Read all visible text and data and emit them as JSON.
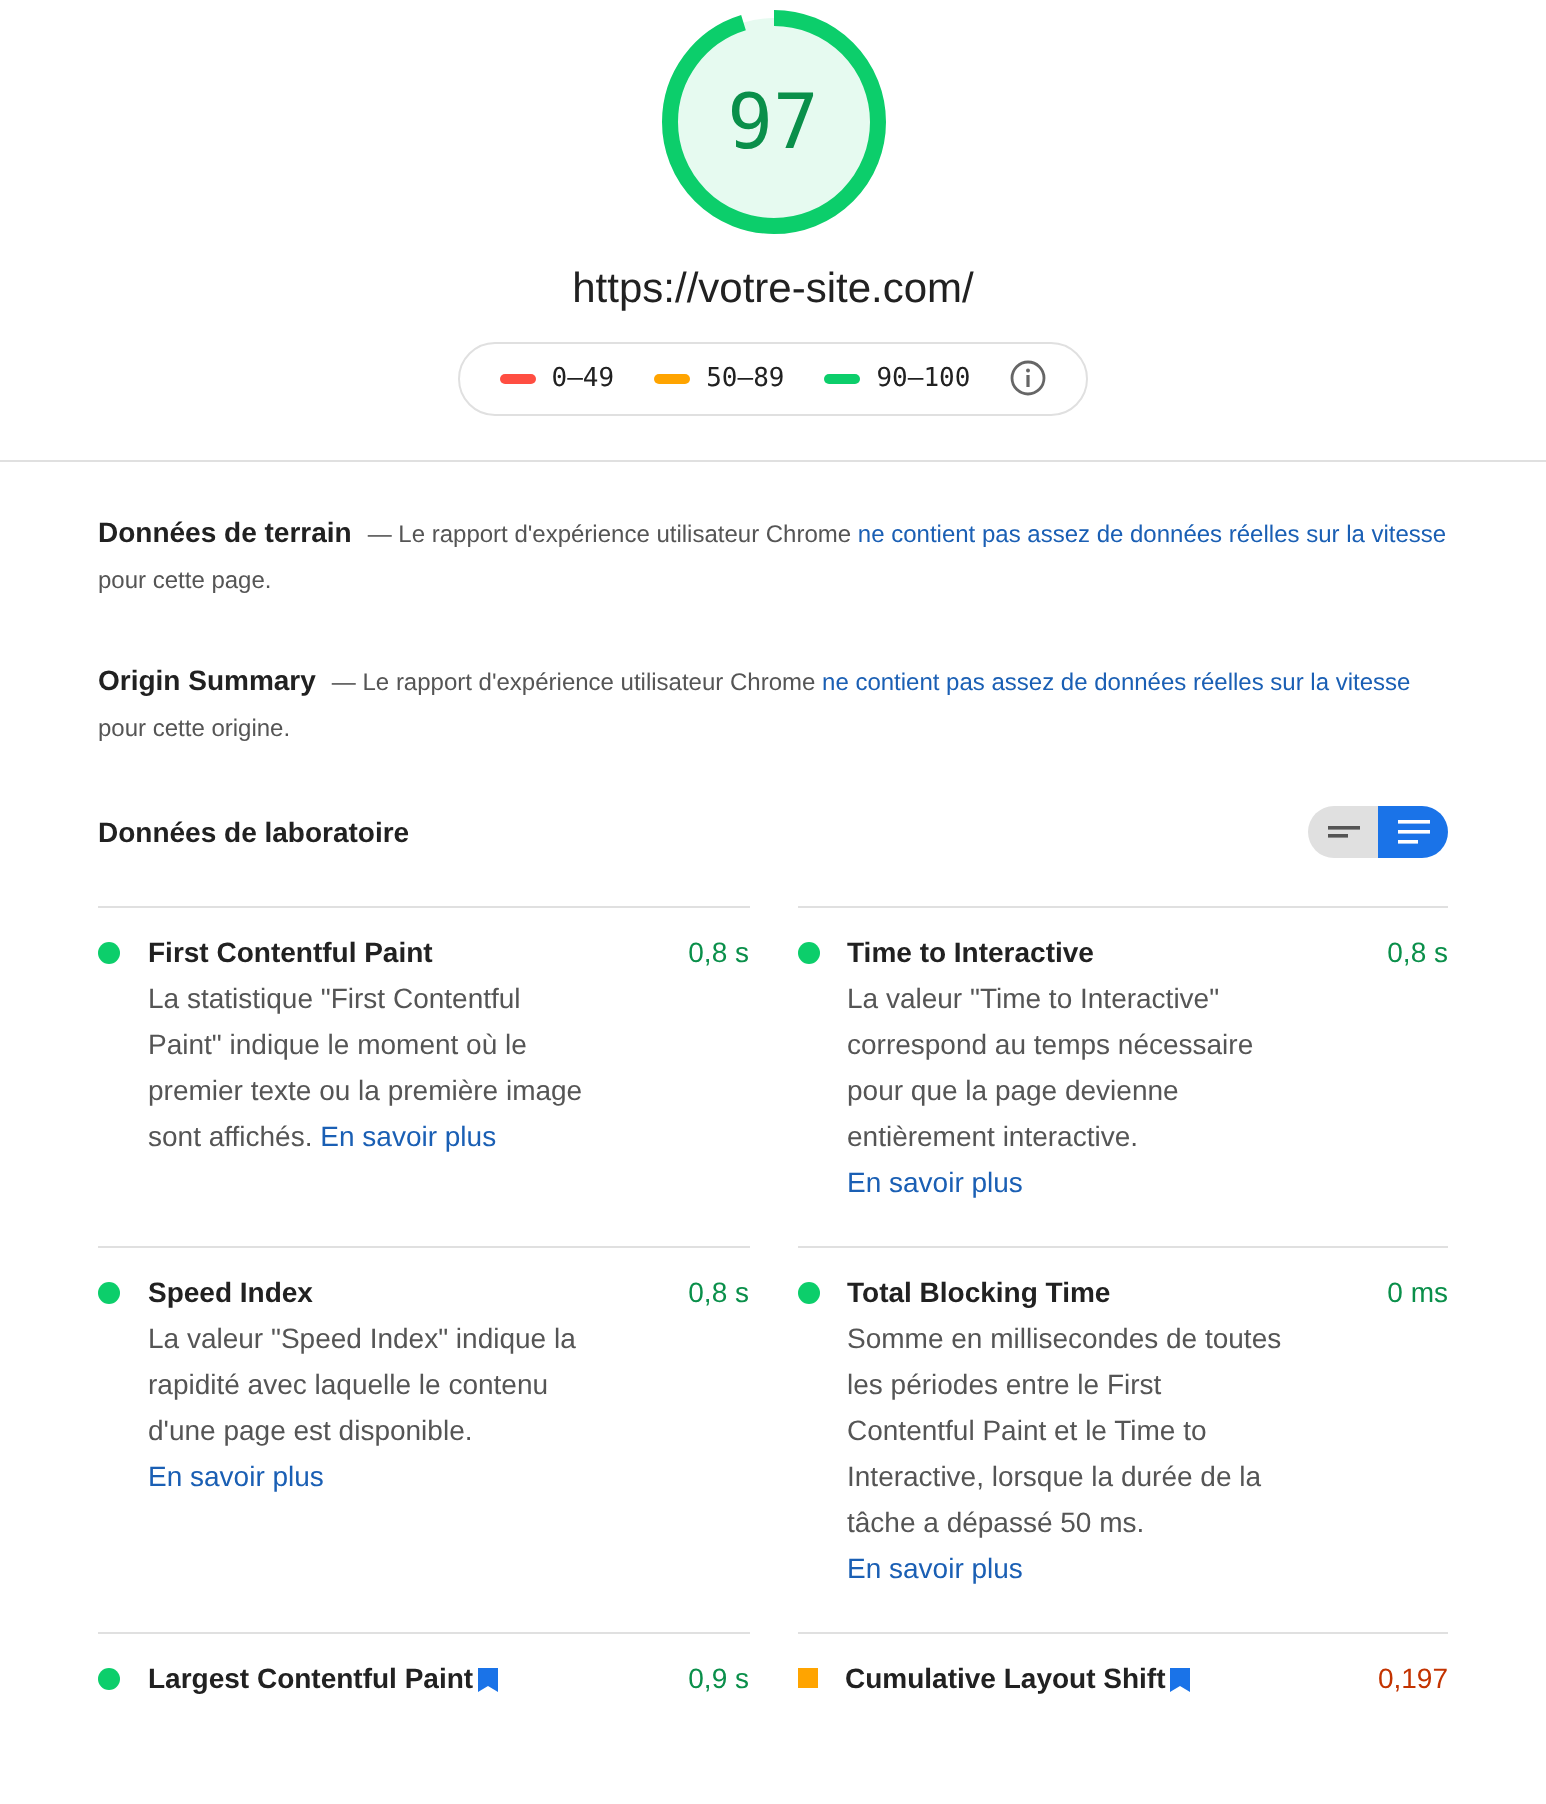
{
  "score": {
    "value": "97",
    "color": "#0cce6b"
  },
  "url": "https://votre-site.com/",
  "legend": [
    {
      "range": "0–49",
      "color": "#ff4e42"
    },
    {
      "range": "50–89",
      "color": "#ffa400"
    },
    {
      "range": "90–100",
      "color": "#0cce6b"
    }
  ],
  "field_sections": [
    {
      "title": "Données de terrain",
      "text_before": "— Le rapport d'expérience utilisateur Chrome",
      "link": "ne contient pas assez de données réelles sur la vitesse",
      "text_after": "pour cette page."
    },
    {
      "title": "Origin Summary",
      "text_before": "— Le rapport d'expérience utilisateur Chrome",
      "link": "ne contient pas assez de données réelles sur la vitesse",
      "text_after": "pour cette origine."
    }
  ],
  "lab": {
    "title": "Données de laboratoire",
    "view_toggle": [
      {
        "kind": "compact",
        "selected": false
      },
      {
        "kind": "expanded",
        "selected": true
      }
    ],
    "metrics": [
      {
        "name": "First Contentful Paint",
        "value": "0,8 s",
        "kind": "circle",
        "color": "#0cce6b",
        "flagged": false,
        "description": "La statistique \"First Contentful Paint\" indique le moment où le premier texte ou la première image sont affichés.",
        "link": "En savoir plus"
      },
      {
        "name": "Time to Interactive",
        "value": "0,8 s",
        "kind": "circle",
        "color": "#0cce6b",
        "flagged": false,
        "description": "La valeur \"Time to Interactive\" correspond au temps nécessaire pour que la page devienne entièrement interactive.",
        "link": "En savoir plus"
      },
      {
        "name": "Speed Index",
        "value": "0,8 s",
        "kind": "circle",
        "color": "#0cce6b",
        "flagged": false,
        "description": "La valeur \"Speed Index\" indique la rapidité avec laquelle le contenu d'une page est disponible.",
        "link": "En savoir plus"
      },
      {
        "name": "Total Blocking Time",
        "value": "0 ms",
        "kind": "circle",
        "color": "#0cce6b",
        "flagged": false,
        "description": "Somme en millisecondes de toutes les périodes entre le First Contentful Paint et le Time to Interactive, lorsque la durée de la tâche a dépassé 50 ms.",
        "link": "En savoir plus"
      },
      {
        "name": "Largest Contentful Paint",
        "value": "0,9 s",
        "kind": "circle",
        "color": "#0cce6b",
        "flagged": true
      },
      {
        "name": "Cumulative Layout Shift",
        "value": "0,197",
        "kind": "square",
        "color": "#ffa400",
        "flagged": true
      }
    ]
  }
}
